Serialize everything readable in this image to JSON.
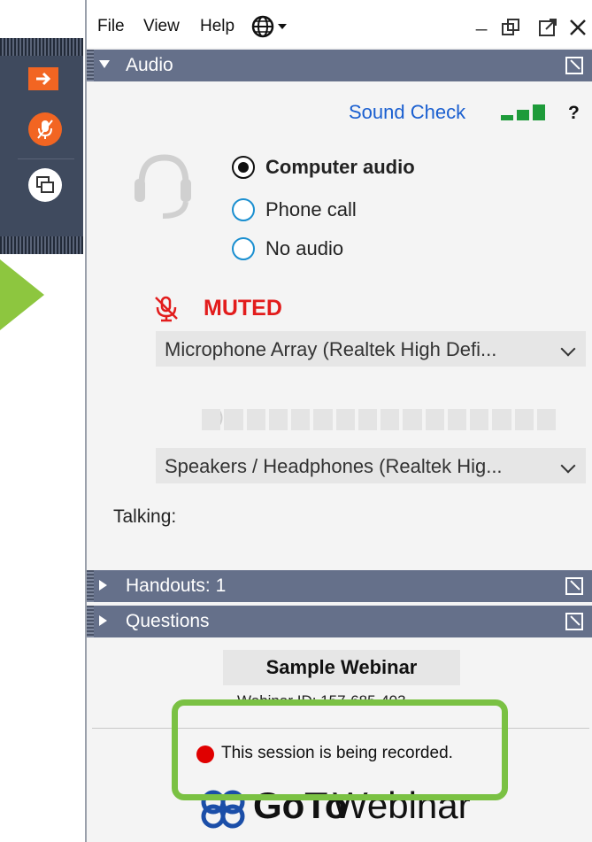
{
  "menu": {
    "file": "File",
    "view": "View",
    "help": "Help"
  },
  "window_controls": {
    "minimize": "_"
  },
  "sections": {
    "audio": "Audio",
    "handouts": "Handouts: 1",
    "questions": "Questions"
  },
  "audio": {
    "sound_check": "Sound Check",
    "help": "?",
    "options": [
      "Computer audio",
      "Phone call",
      "No audio"
    ],
    "selected_option": "Computer audio",
    "muted_label": "MUTED",
    "microphone": "Microphone Array (Realtek High Defi...",
    "speakers": "Speakers / Headphones (Realtek Hig...",
    "talking_label": "Talking:"
  },
  "webinar": {
    "title": "Sample Webinar",
    "id_line": "Webinar ID: 157-685-403",
    "recording_notice": "This session is being recorded.",
    "logo_goto": "GoTo",
    "logo_webinar": "Webinar"
  },
  "colors": {
    "accent_orange": "#f26522",
    "section_header": "#65708a",
    "link_blue": "#1a5fd0",
    "record_red": "#e00000",
    "highlight_green": "#7ac143"
  }
}
